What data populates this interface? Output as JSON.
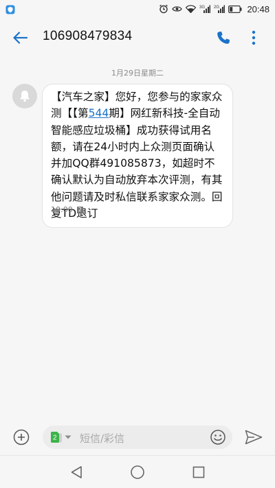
{
  "status_bar": {
    "time": "20:48",
    "signal1_label": "3G",
    "signal2_label": "2G",
    "icons": [
      "shield-icon",
      "alarm-icon",
      "eye-icon",
      "wifi-icon",
      "signal-icon",
      "battery-icon"
    ]
  },
  "header": {
    "title": "106908479834",
    "icons": [
      "back-arrow-icon",
      "phone-icon",
      "more-vert-icon"
    ]
  },
  "conversation": {
    "date": "1月29日星期二",
    "message": {
      "text_before_link": "【汽车之家】您好，您参与的家家众测【【第",
      "link_text": "544",
      "text_after_link": "期】网红新科技-全自动智能感应垃圾桶】成功获得试用名额，请在24小时内上众测页面确认并加QQ群491085873，如超时不确认默认为自动放弃本次评测，有其他问题请及时私信联系家家众测。回复TD退订",
      "time": "10:00",
      "sim_slot": "2"
    }
  },
  "compose": {
    "placeholder": "短信/彩信",
    "sim_selector": "2",
    "icons": [
      "add-circle-icon",
      "sim-card-icon",
      "dropdown-arrow-icon",
      "emoji-icon",
      "send-icon"
    ]
  },
  "nav_bar": {
    "icons": [
      "nav-back-icon",
      "nav-home-icon",
      "nav-recents-icon"
    ]
  },
  "colors": {
    "background": "#f6f6f6",
    "accent": "#1a73c8",
    "bubble": "#ffffff",
    "sim_green": "#3cb34a"
  }
}
